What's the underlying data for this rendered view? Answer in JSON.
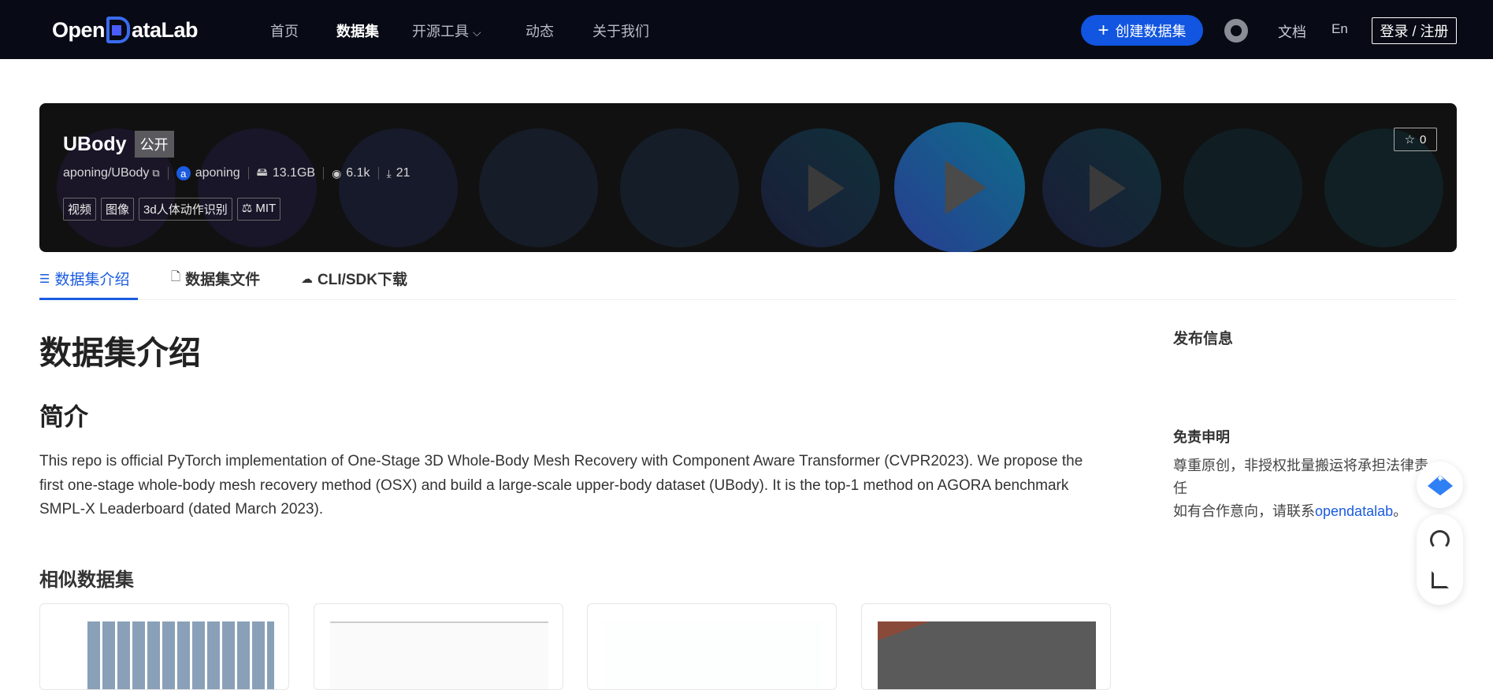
{
  "nav": {
    "logo": "OpenDataLab",
    "items": [
      "首页",
      "数据集",
      "开源工具",
      "动态",
      "关于我们"
    ],
    "create_label": "创建数据集",
    "docs": "文档",
    "lang": "En",
    "login": "登录 / 注册"
  },
  "dataset": {
    "title": "UBody",
    "visibility": "公开",
    "repo": "aponing/UBody",
    "owner_initial": "a",
    "owner": "aponing",
    "size": "13.1GB",
    "views": "6.1k",
    "downloads": "21",
    "tags": [
      "视频",
      "图像",
      "3d人体动作识别"
    ],
    "license": "MIT",
    "stars": "0"
  },
  "tabs": [
    "数据集介绍",
    "数据集文件",
    "CLI/SDK下载"
  ],
  "content": {
    "heading": "数据集介绍",
    "subheading": "简介",
    "paragraph": "This repo is official PyTorch implementation of One-Stage 3D Whole-Body Mesh Recovery with Component Aware Transformer (CVPR2023). We propose the first one-stage whole-body mesh recovery method (OSX) and build a large-scale upper-body dataset (UBody). It is the top-1 method on AGORA benchmark SMPL-X Leaderboard (dated March 2023).",
    "similar_heading": "相似数据集"
  },
  "sidebar": {
    "publish_heading": "发布信息",
    "disclaimer_heading": "免责申明",
    "disclaimer_line1": "尊重原创，非授权批量搬运将承担法律责任",
    "disclaimer_line2_prefix": "如有合作意向，请联系",
    "disclaimer_link": "opendatalab",
    "disclaimer_suffix": "。"
  },
  "colors": {
    "accent": "#1a5be0",
    "nav_bg": "#080b16",
    "banner_bg": "#111111"
  }
}
